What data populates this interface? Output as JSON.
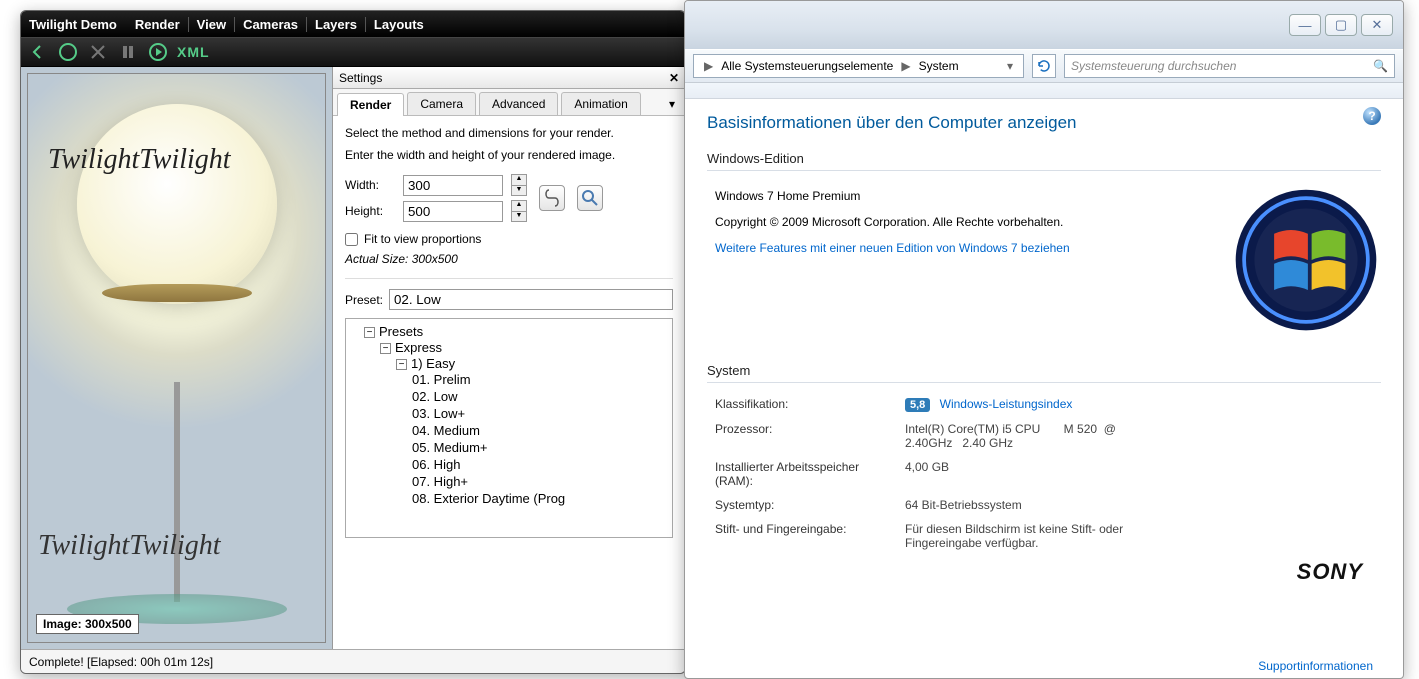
{
  "twilight": {
    "title": "Twilight Demo",
    "menu": [
      "Render",
      "View",
      "Cameras",
      "Layers",
      "Layouts"
    ],
    "toolbar": {
      "xml_label": "XML"
    },
    "preview": {
      "watermark1": "TwilightTwilight",
      "watermark2": "TwilightTwilight",
      "image_label": "Image: 300x500"
    },
    "settings": {
      "title": "Settings",
      "tabs": [
        "Render",
        "Camera",
        "Advanced",
        "Animation"
      ],
      "active_tab": "Render",
      "desc1": "Select the method and dimensions for your render.",
      "desc2": "Enter the width and height of your rendered image.",
      "width_label": "Width:",
      "width_value": "300",
      "height_label": "Height:",
      "height_value": "500",
      "fit_label": "Fit to view proportions",
      "actual_label": "Actual Size: 300x500",
      "preset_label": "Preset:",
      "preset_value": "02. Low",
      "tree": {
        "root": "Presets",
        "group": "Express",
        "easy": "1) Easy",
        "items": [
          "01. Prelim",
          "02. Low",
          "03. Low+",
          "04. Medium",
          "05. Medium+",
          "06. High",
          "07. High+",
          "08. Exterior Daytime (Prog"
        ]
      }
    },
    "status": "Complete!  [Elapsed: 00h 01m 12s]"
  },
  "win": {
    "breadcrumb": {
      "level1": "Alle Systemsteuerungselemente",
      "level2": "System"
    },
    "search_placeholder": "Systemsteuerung durchsuchen",
    "heading": "Basisinformationen über den Computer anzeigen",
    "edition_title": "Windows-Edition",
    "edition_name": "Windows 7 Home Premium",
    "copyright": "Copyright © 2009 Microsoft Corporation. Alle Rechte vorbehalten.",
    "features_link": "Weitere Features mit einer neuen Edition von Windows 7 beziehen",
    "system_title": "System",
    "rows": {
      "rating_label": "Klassifikation:",
      "rating_value": "5,8",
      "rating_link": "Windows-Leistungsindex",
      "cpu_label": "Prozessor:",
      "cpu_value": "Intel(R) Core(TM) i5 CPU       M 520  @ 2.40GHz   2.40 GHz",
      "ram_label": "Installierter Arbeitsspeicher (RAM):",
      "ram_value": "4,00 GB",
      "type_label": "Systemtyp:",
      "type_value": "64 Bit-Betriebssystem",
      "pen_label": "Stift- und Fingereingabe:",
      "pen_value": "Für diesen Bildschirm ist keine Stift- oder Fingereingabe verfügbar."
    },
    "brand": "SONY",
    "support_link": "Supportinformationen"
  }
}
